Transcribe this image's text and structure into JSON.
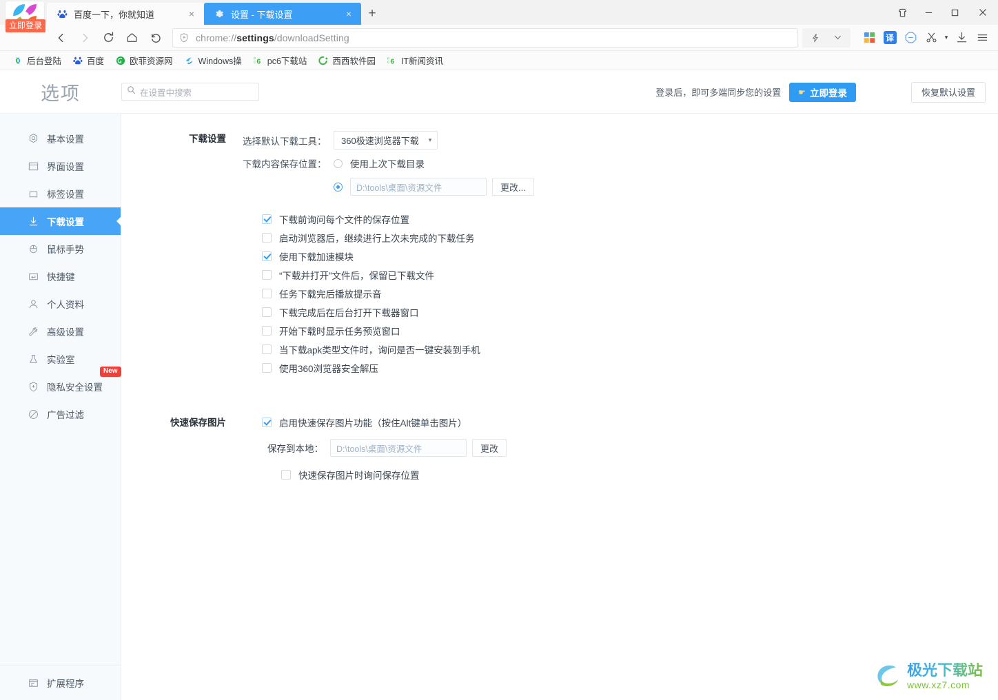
{
  "window": {
    "controls": [
      {
        "name": "skin-icon",
        "glyph": "skin"
      },
      {
        "name": "minimize",
        "glyph": "minimize"
      },
      {
        "name": "maximize",
        "glyph": "maximize"
      },
      {
        "name": "close",
        "glyph": "close"
      }
    ]
  },
  "logo": {
    "badge_label": "立即登录",
    "icon": "360-pinwheel-logo"
  },
  "tabs": [
    {
      "title": "百度一下，你就知道",
      "favicon": "baidu-paw-icon",
      "active": false,
      "close_label": "×"
    },
    {
      "title": "设置 - 下载设置",
      "favicon": "gear-icon",
      "active": true,
      "close_label": "×"
    }
  ],
  "newtab_label": "+",
  "toolbar": {
    "back_label": "‹",
    "forward_label": "›",
    "reload_label": "reload-icon",
    "home_label": "home-icon",
    "undo_label": "undo-icon",
    "url_prefix": "chrome://",
    "url_bold": "settings",
    "url_suffix": "/downloadSetting",
    "shield_icon": "shield-plus-icon",
    "lightning_icon": "lightning-icon",
    "chevron_icon": "chevron-down-icon",
    "icons": [
      {
        "name": "windows-tiles-icon",
        "label": ""
      },
      {
        "name": "translate-icon",
        "label": "译"
      },
      {
        "name": "block-ad-icon",
        "label": ""
      },
      {
        "name": "scissors-screenshot-icon",
        "label": ""
      },
      {
        "name": "screenshot-caret-icon",
        "label": "▾"
      },
      {
        "name": "download-icon",
        "label": ""
      },
      {
        "name": "menu-icon",
        "label": ""
      }
    ]
  },
  "bookmarks": [
    {
      "label": "后台登陆",
      "icon": "green-s-icon",
      "trailing": "-"
    },
    {
      "label": "百度",
      "icon": "baidu-paw-icon",
      "trailing": ""
    },
    {
      "label": "欧菲资源网",
      "icon": "green-circle-icon",
      "trailing": ""
    },
    {
      "label": "Windows操",
      "icon": "blue-win-icon",
      "trailing": ""
    },
    {
      "label": "pc6下载站",
      "icon": "pc6-icon",
      "trailing": "-"
    },
    {
      "label": "西西软件园",
      "icon": "green-c-icon",
      "trailing": "-"
    },
    {
      "label": "IT新闻资讯",
      "icon": "pc6-icon",
      "trailing": ""
    }
  ],
  "page": {
    "brand": "选项",
    "search_placeholder": "在设置中搜索",
    "search_icon": "search-icon",
    "header_note": "登录后，即可多端同步您的设置",
    "login_button": "立即登录",
    "login_hand_icon": "pointing-hand-icon",
    "reset_button": "恢复默认设置"
  },
  "sidebar": {
    "items": [
      {
        "label": "基本设置",
        "icon": "hexagon-gear-icon",
        "active": false,
        "badge": ""
      },
      {
        "label": "界面设置",
        "icon": "window-icon",
        "active": false,
        "badge": ""
      },
      {
        "label": "标签设置",
        "icon": "tab-icon",
        "active": false,
        "badge": ""
      },
      {
        "label": "下载设置",
        "icon": "download-arrow-icon",
        "active": true,
        "badge": ""
      },
      {
        "label": "鼠标手势",
        "icon": "mouse-icon",
        "active": false,
        "badge": ""
      },
      {
        "label": "快捷键",
        "icon": "keyboard-key-icon",
        "active": false,
        "badge": ""
      },
      {
        "label": "个人资料",
        "icon": "person-icon",
        "active": false,
        "badge": ""
      },
      {
        "label": "高级设置",
        "icon": "wrench-icon",
        "active": false,
        "badge": ""
      },
      {
        "label": "实验室",
        "icon": "flask-icon",
        "active": false,
        "badge": ""
      },
      {
        "label": "隐私安全设置",
        "icon": "shield-plus-icon",
        "active": false,
        "badge": "New"
      },
      {
        "label": "广告过滤",
        "icon": "circle-slash-icon",
        "active": false,
        "badge": ""
      }
    ],
    "bottom": {
      "label": "扩展程序",
      "icon": "extension-icon"
    }
  },
  "download_section": {
    "title": "下载设置",
    "tool_label": "选择默认下载工具：",
    "tool_value": "360极速浏览器下载",
    "tool_caret": "▾",
    "location_label": "下载内容保存位置：",
    "radio_last_dir": {
      "label": "使用上次下载目录",
      "selected": false
    },
    "radio_custom": {
      "selected": true,
      "path": "D:\\tools\\桌面\\资源文件",
      "change_button": "更改..."
    },
    "checkboxes": [
      {
        "label": "下载前询问每个文件的保存位置",
        "checked": true
      },
      {
        "label": "启动浏览器后，继续进行上次未完成的下载任务",
        "checked": false
      },
      {
        "label": "使用下载加速模块",
        "checked": true
      },
      {
        "label": "“下载并打开”文件后，保留已下载文件",
        "checked": false
      },
      {
        "label": "任务下载完后播放提示音",
        "checked": false
      },
      {
        "label": "下载完成后在后台打开下载器窗口",
        "checked": false
      },
      {
        "label": "开始下载时显示任务预览窗口",
        "checked": false
      },
      {
        "label": "当下载apk类型文件时，询问是否一键安装到手机",
        "checked": false
      },
      {
        "label": "使用360浏览器安全解压",
        "checked": false
      }
    ]
  },
  "quicksave_section": {
    "title": "快速保存图片",
    "enable": {
      "label": "启用快速保存图片功能（按住Alt键单击图片）",
      "checked": true
    },
    "save_label": "保存到本地：",
    "save_path": "D:\\tools\\桌面\\资源文件",
    "change_button": "更改",
    "ask_location": {
      "label": "快速保存图片时询问保存位置",
      "checked": false
    }
  },
  "watermark": {
    "cn": "极光下载站",
    "en": "www.xz7.com"
  },
  "colors": {
    "accent": "#3d9ef5",
    "active_tab": "#3d9ef5",
    "sidebar_active": "#48a4f7",
    "login_button": "#2f9bf3",
    "badge_red": "#f0403a",
    "logo_badge": "#f96a4d"
  }
}
